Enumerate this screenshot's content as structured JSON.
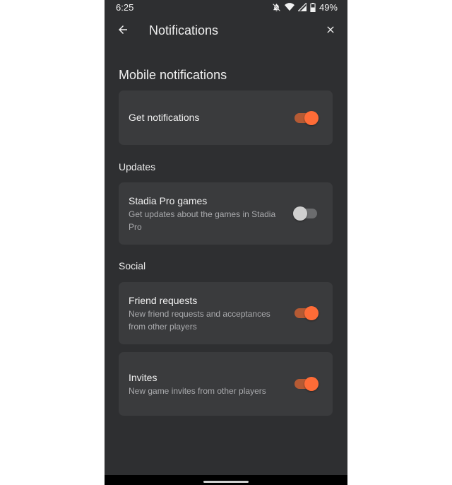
{
  "status_bar": {
    "time": "6:25",
    "battery": "49%",
    "icons": [
      "bell-off-icon",
      "wifi-icon",
      "signal-icon",
      "battery-icon"
    ]
  },
  "app_bar": {
    "title": "Notifications",
    "back_icon": "arrow-left-icon",
    "close_icon": "close-icon"
  },
  "section_title": "Mobile notifications",
  "main_toggle": {
    "title": "Get notifications",
    "on": true
  },
  "groups": {
    "updates": {
      "label": "Updates",
      "items": [
        {
          "title": "Stadia Pro games",
          "subtitle": "Get updates about the games in Stadia Pro",
          "on": false
        }
      ]
    },
    "social": {
      "label": "Social",
      "items": [
        {
          "title": "Friend requests",
          "subtitle": "New friend requests and acceptances from other players",
          "on": true
        },
        {
          "title": "Invites",
          "subtitle": "New game invites from other players",
          "on": true
        }
      ]
    }
  },
  "colors": {
    "background": "#2e2f31",
    "card": "#3a3b3d",
    "accent": "#ff6c37",
    "accent_track": "#b55a34"
  }
}
